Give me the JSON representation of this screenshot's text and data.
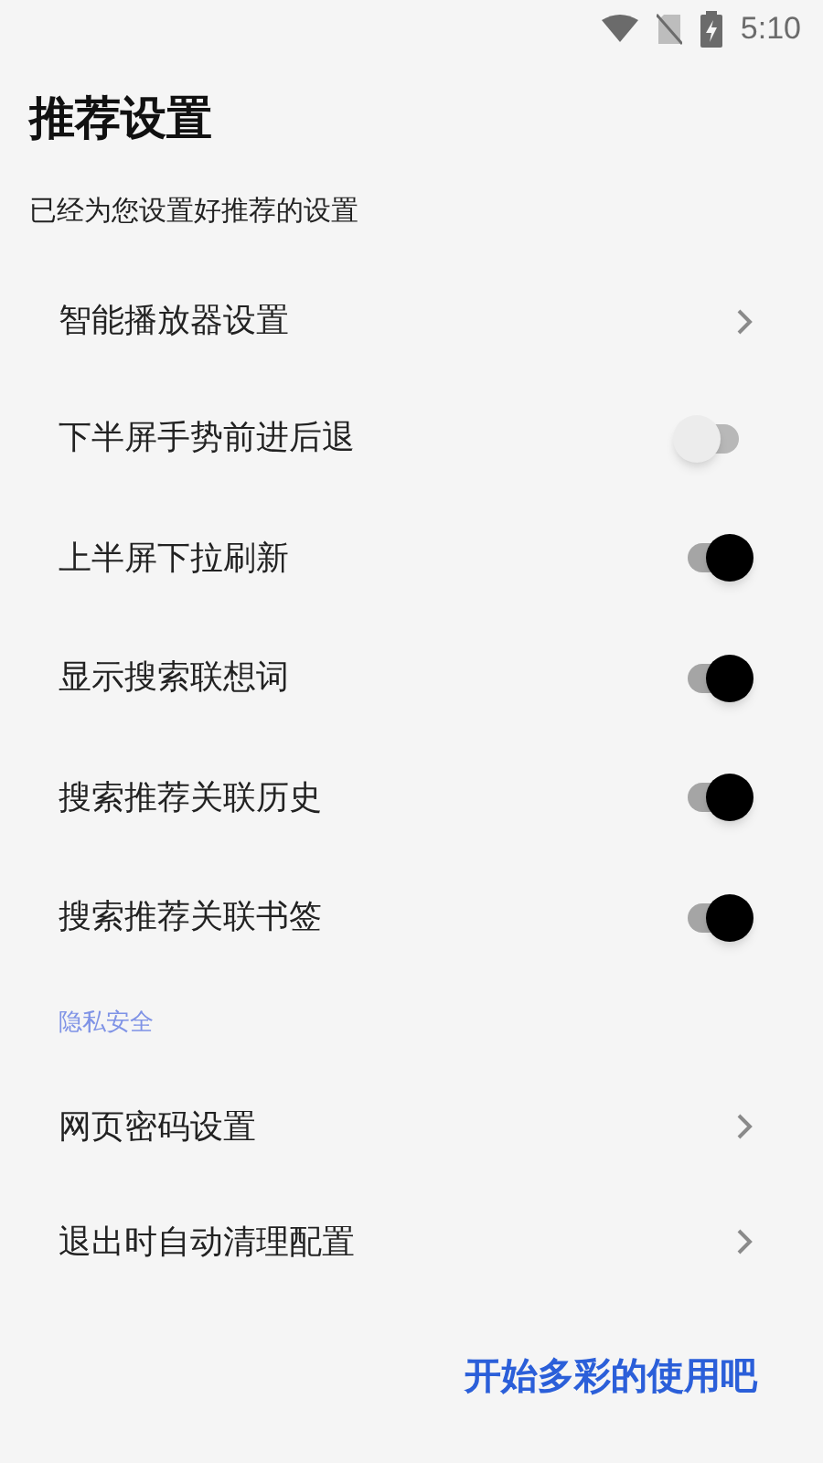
{
  "status_bar": {
    "time": "5:10"
  },
  "title": "推荐设置",
  "subtitle": "已经为您设置好推荐的设置",
  "items": [
    {
      "kind": "link",
      "label": "智能播放器设置"
    },
    {
      "kind": "switch",
      "label": "下半屏手势前进后退",
      "on": false
    },
    {
      "kind": "switch",
      "label": "上半屏下拉刷新",
      "on": true
    },
    {
      "kind": "switch",
      "label": "显示搜索联想词",
      "on": true
    },
    {
      "kind": "switch",
      "label": "搜索推荐关联历史",
      "on": true
    },
    {
      "kind": "switch",
      "label": "搜索推荐关联书签",
      "on": true
    },
    {
      "kind": "header",
      "label": "隐私安全"
    },
    {
      "kind": "link",
      "label": "网页密码设置"
    },
    {
      "kind": "link",
      "label": "退出时自动清理配置"
    }
  ],
  "start_button": "开始多彩的使用吧"
}
